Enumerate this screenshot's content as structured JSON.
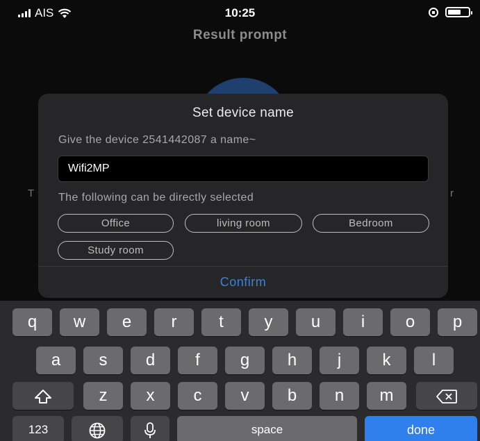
{
  "status_bar": {
    "carrier": "AIS",
    "time": "10:25"
  },
  "background": {
    "title": "Result prompt",
    "left_fragment": "T",
    "right_fragment": "r"
  },
  "dialog": {
    "title": "Set device name",
    "subtitle": "Give the device 2541442087 a name~",
    "name_value": "Wifi2MP",
    "hint": "The following can be directly selected",
    "chips": [
      "Office",
      "living room",
      "Bedroom",
      "Study room"
    ],
    "confirm_label": "Confirm"
  },
  "keyboard": {
    "row1": [
      "q",
      "w",
      "e",
      "r",
      "t",
      "y",
      "u",
      "i",
      "o",
      "p"
    ],
    "row2": [
      "a",
      "s",
      "d",
      "f",
      "g",
      "h",
      "j",
      "k",
      "l"
    ],
    "row3": [
      "z",
      "x",
      "c",
      "v",
      "b",
      "n",
      "m"
    ],
    "numbers_label": "123",
    "space_label": "space",
    "done_label": "done",
    "icons": {
      "shift": "shift-arrow-icon",
      "delete": "backspace-icon",
      "globe": "globe-icon",
      "mic": "microphone-icon"
    }
  },
  "colors": {
    "accent": "#3b82d6",
    "done_key": "#2f80ed",
    "dialog_bg": "#262628",
    "keyboard_bg": "#2b2b2d"
  }
}
